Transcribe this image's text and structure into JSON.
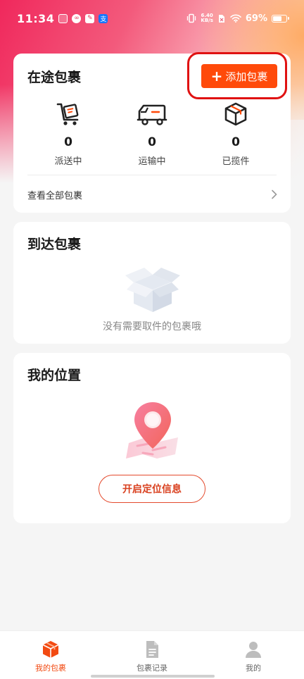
{
  "status_bar": {
    "time": "11:34",
    "speed_value": "6.40",
    "speed_unit": "KB/s",
    "battery_text": "69%",
    "battery_level": 0.69
  },
  "transit": {
    "title": "在途包裹",
    "add_button": "添加包裹",
    "stats": [
      {
        "count": "0",
        "label": "派送中",
        "icon": "courier-cart-icon"
      },
      {
        "count": "0",
        "label": "运输中",
        "icon": "truck-icon"
      },
      {
        "count": "0",
        "label": "已揽件",
        "icon": "package-box-icon"
      }
    ],
    "view_all": "查看全部包裹"
  },
  "arrived": {
    "title": "到达包裹",
    "empty_text": "没有需要取件的包裹哦"
  },
  "location": {
    "title": "我的位置",
    "button": "开启定位信息"
  },
  "nav": [
    {
      "label": "我的包裹",
      "active": true
    },
    {
      "label": "包裹记录",
      "active": false
    },
    {
      "label": "我的",
      "active": false
    }
  ],
  "colors": {
    "accent": "#ff4a0a",
    "highlight": "#e01212",
    "nav_active": "#f24a12"
  }
}
